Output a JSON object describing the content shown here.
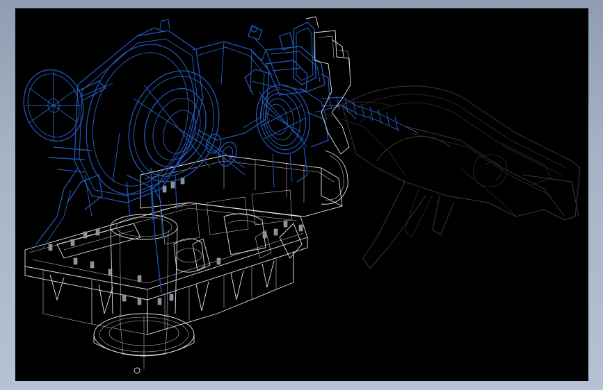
{
  "colors": {
    "frame": "#a6b3c6",
    "viewport_background": "#000000",
    "selected_component": "#1f52b0",
    "unselected_wire": "#e8e8e8",
    "hidden_component": "#3a3a3a",
    "fastener": "#8a8f96"
  },
  "scene": {
    "view_mode": "wireframe",
    "components": [
      {
        "name": "handwheel",
        "state": "selected"
      },
      {
        "name": "gearbox-housing",
        "state": "selected"
      },
      {
        "name": "flange-ring",
        "state": "selected"
      },
      {
        "name": "motor-coil",
        "state": "selected"
      },
      {
        "name": "support-bracket",
        "state": "selected"
      },
      {
        "name": "base-frame",
        "state": "unselected"
      },
      {
        "name": "bottom-flange",
        "state": "unselected"
      },
      {
        "name": "discharge-chute",
        "state": "hidden"
      }
    ]
  }
}
